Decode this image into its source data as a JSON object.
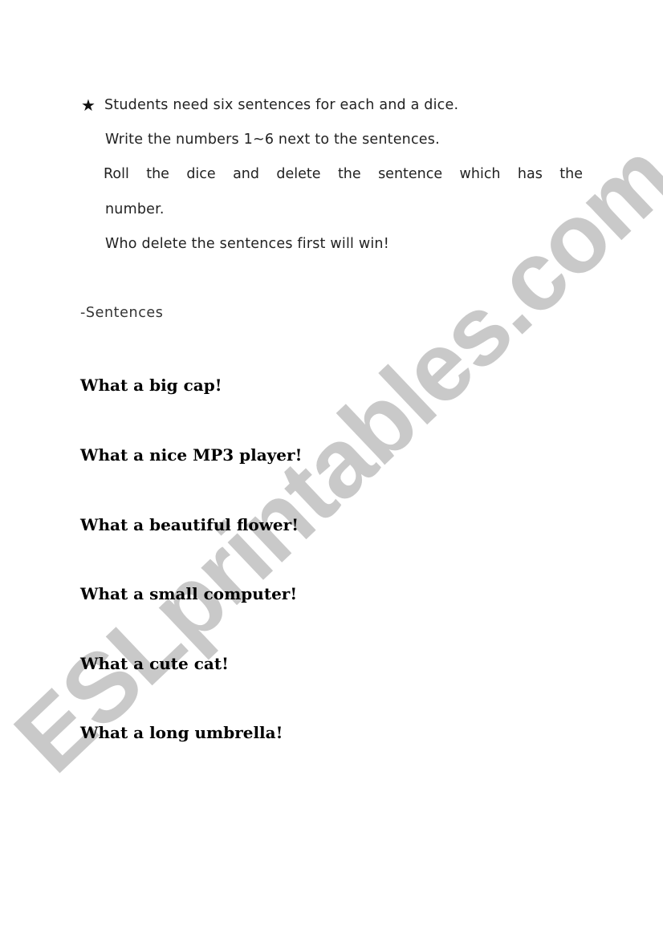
{
  "watermark": {
    "text": "ESLprintables.com",
    "color": "#c9c9c9"
  },
  "instructions": {
    "bullet_icon": "black-star",
    "bullet_glyph": "★",
    "lines": [
      "Students need six sentences for each and a dice.",
      "Write the numbers 1~6 next to the sentences.",
      "Roll the dice and delete the sentence which has the",
      "number.",
      "Who delete the sentences first will win!"
    ]
  },
  "section": {
    "label": "-Sentences"
  },
  "sentences": [
    "What a big cap!",
    "What a nice MP3 player!",
    "What a beautiful flower!",
    "What a small computer!",
    "What a cute cat!",
    "What a long umbrella!"
  ]
}
